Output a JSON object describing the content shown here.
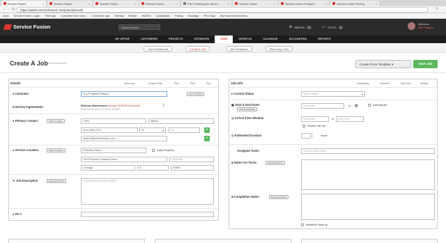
{
  "browser": {
    "tabs": [
      "Service Fusion",
      "Service Fusion",
      "Service Fusion",
      "Service Fusion",
      "FSC Plumbing do the Au",
      "Service Fusion",
      "Service Fusion Product I",
      "Service Fusion Pricing"
    ],
    "url": "https://admin.servicefusion.com/jobs/jobsAdd",
    "bookmarks": [
      "Apps",
      "Service Fusion - Login",
      "Field app",
      "Complete Care Carp...",
      "Consumer app",
      "Training",
      "Nimble",
      "sfs2019",
      "QuickBooks",
      "Pricing",
      "Docusign",
      "Fill n Sign",
      "My Voicemail Business"
    ]
  },
  "header": {
    "logo_text": "Service Fusion",
    "search_placeholder": "Global Search",
    "memos_label": "MEMOS",
    "memos_count": "0",
    "texts_label": "TEXTS",
    "texts_count": "0",
    "welcome": "Welcome",
    "user_name": "Matt Pattison"
  },
  "nav": [
    "MY OFFICE",
    "CUSTOMERS",
    "PROJECTS",
    "ESTIMATES",
    "JOBS",
    "DISPATCH",
    "CALENDAR",
    "ACCOUNTING",
    "REPORTS"
  ],
  "subnav": [
    "Jobs Dashboard",
    "Create a Job",
    "Job Templates",
    "Recurring Jobs"
  ],
  "page": {
    "title": "Create A Job",
    "subtitle": "Enter job details",
    "create_from_template": "Create From Template",
    "save_job": "Save Job"
  },
  "details": {
    "heading": "Details",
    "tabs": [
      "Summary",
      "Custom Flds",
      "PDs",
      "Print",
      "Pay"
    ],
    "customer_label": "Customer",
    "customer_value": "Sun Property Partners",
    "link_to_parent": "Link To Parent",
    "agreements_label": "Service Agreements",
    "agreement_name": "Platinum Maintenance",
    "agreement_through": "through 09/30/2019 (expired)",
    "agreement_line2": "Show overlap jobs | 0 to ten(s) #3 ($821)",
    "primary_contact_label": "Primary Contact",
    "select_contact": "Select Contact",
    "first_name": "Chris",
    "last_name": "Martin",
    "phone": "(214) 555-1212",
    "phone_type": "M",
    "ext_placeholder": "Ext",
    "email": "shaun2@servicefusion.com",
    "service_location_label": "Service Location",
    "select_location": "Select Location",
    "location_name": "Parkview Plaza",
    "gated_label": "Gated Property",
    "street": "1413 Munnich Campus Drive",
    "unit_placeholder": "Unit/Suite",
    "city": "Chicago",
    "state": "IL",
    "zip": "60606",
    "job_description_label": "Job Description",
    "expand_window": "Expand Window",
    "description_placeholder": "Describe your service needs",
    "po_label": "PO #"
  },
  "jobinfo": {
    "heading": "Job Info",
    "tabs": [
      "Scheduling",
      "Payment",
      "Add'l Info",
      "Activity"
    ],
    "current_status_label": "Current Status",
    "status_placeholder": "Select Status",
    "start_end_label": "Start & End Dates",
    "check_availability": "Check Availability",
    "start_date_placeholder": "Start Date",
    "to_label": "to",
    "end_date_placeholder": "End Date",
    "multiday_label": "Multi-day job",
    "arrival_label": "Arrival Time Window",
    "start_time_placeholder": "Start Time",
    "end_time_placeholder": "End Time",
    "repeat_label": "Repeat This Job",
    "duration_label": "Estimated Duration",
    "hours_label": "Hours",
    "assigned_techs_label": "Assigned Techs",
    "techs_placeholder": "Click to select techs",
    "notes_techs_label": "Notes For Techs",
    "completion_notes_label": "Completion Notes",
    "requires_followup": "Requires Follow-up"
  }
}
